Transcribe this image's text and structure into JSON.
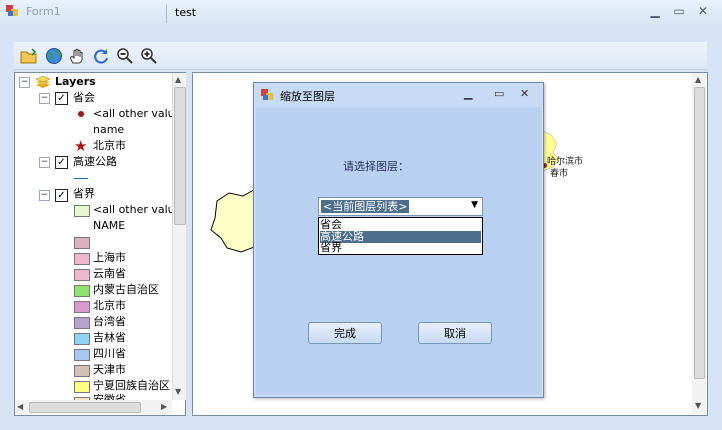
{
  "window": {
    "title": "Form1"
  },
  "toolbar": {
    "label": "test"
  },
  "toc": {
    "root": "Layers",
    "layers": [
      {
        "name": "省会",
        "items": [
          "<all other values",
          "name",
          "北京市"
        ]
      },
      {
        "name": "高速公路"
      },
      {
        "name": "省界",
        "items": [
          "<all other values",
          "NAME",
          "",
          "上海市",
          "云南省",
          "内蒙古自治区",
          "北京市",
          "台湾省",
          "吉林省",
          "四川省",
          "天津市",
          "宁夏回族自治区",
          "安徽省"
        ]
      }
    ]
  },
  "map": {
    "labels": [
      "哈尔滨市",
      "春市"
    ]
  },
  "dialog": {
    "title": "缩放至图层",
    "prompt": "请选择图层：",
    "combo_value": "<当前图层列表>",
    "options": [
      "省会",
      "高速公路",
      "省界"
    ],
    "selected_index": 1,
    "ok": "完成",
    "cancel": "取消"
  },
  "colors": {
    "dialog_bg": "#b9d1f1",
    "selected_option": "#4e6e8e",
    "swatches": [
      "#e8f7d2",
      "#dcb0bf",
      "#f0b8cf",
      "#8fe36f",
      "#d99ad0",
      "#b4a2cf",
      "#8fd3f4",
      "#a7c7f2",
      "#d5c0b4",
      "#ffff80"
    ]
  }
}
